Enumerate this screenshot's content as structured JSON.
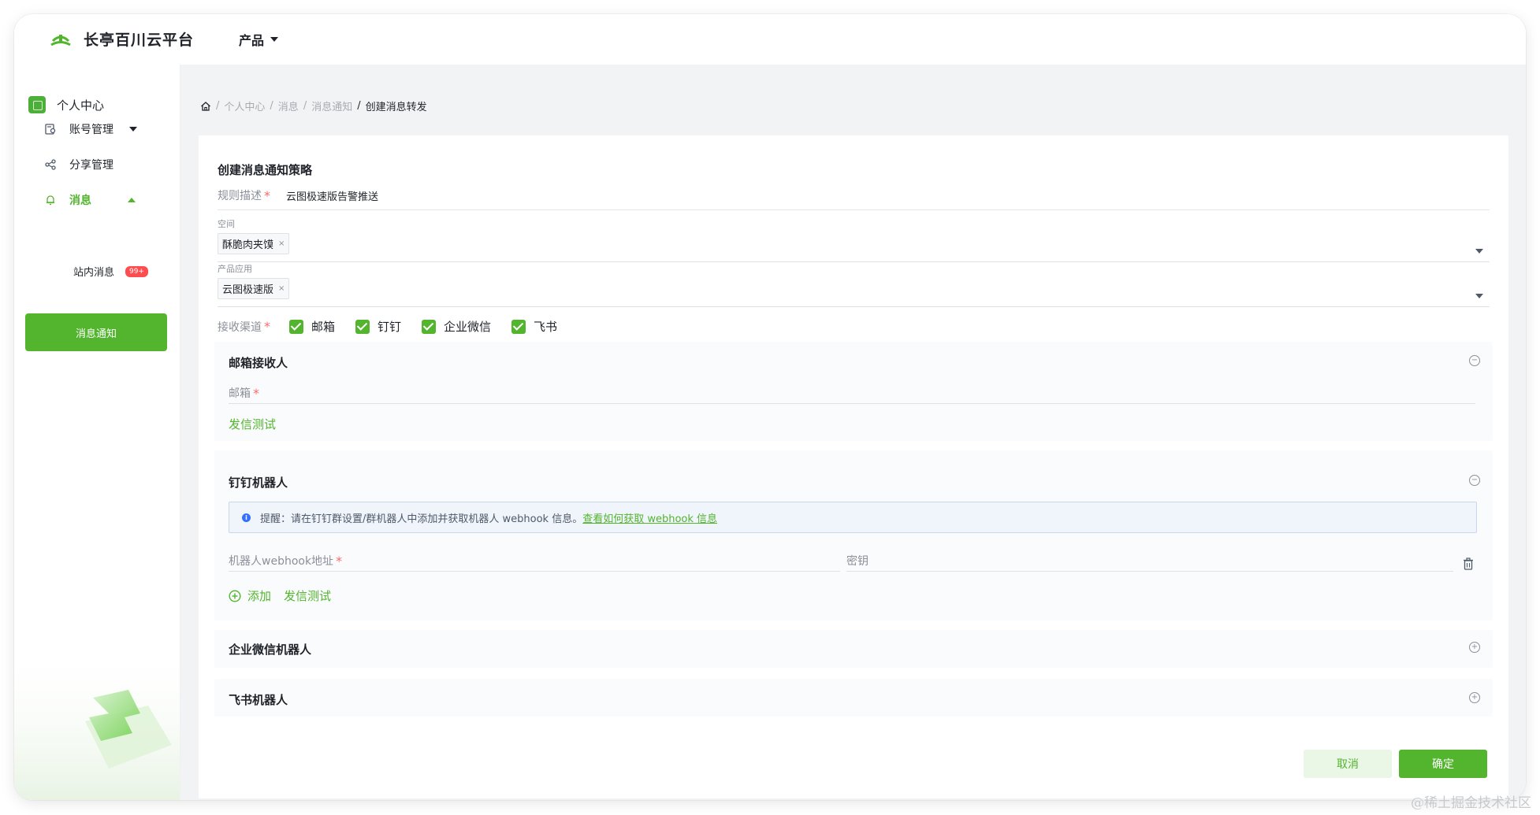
{
  "app": {
    "brand": "长亭百川云平台",
    "product_menu": "产品"
  },
  "sidebar": {
    "header": "个人中心",
    "items": [
      {
        "label": "账号管理",
        "icon": "account-icon"
      },
      {
        "label": "分享管理",
        "icon": "share-icon"
      },
      {
        "label": "消息",
        "icon": "bell-icon"
      }
    ],
    "sub_items": [
      {
        "label": "站内消息",
        "badge": "99+"
      },
      {
        "label": "消息通知"
      }
    ]
  },
  "breadcrumb": {
    "items": [
      "个人中心",
      "消息",
      "消息通知"
    ],
    "current": "创建消息转发"
  },
  "form": {
    "title": "创建消息通知策略",
    "desc_label": "规则描述",
    "desc_value": "云图极速版告警推送",
    "space_label": "空间",
    "space_tag": "酥脆肉夹馍",
    "app_label": "产品应用",
    "app_tag": "云图极速版",
    "channel_label": "接收渠道",
    "channels": [
      "邮箱",
      "钉钉",
      "企业微信",
      "飞书"
    ],
    "required_mark": "*",
    "tag_close": "×"
  },
  "email_section": {
    "title": "邮箱接收人",
    "field_label": "邮箱",
    "test_link": "发信测试"
  },
  "dingtalk_section": {
    "title": "钉钉机器人",
    "tip_text": "提醒：请在钉钉群设置/群机器人中添加并获取机器人 webhook 信息。",
    "tip_link": "查看如何获取 webhook 信息",
    "webhook_label": "机器人webhook地址",
    "secret_label": "密钥",
    "add_label": "添加",
    "test_link": "发信测试"
  },
  "wecom_section": {
    "title": "企业微信机器人"
  },
  "feishu_section": {
    "title": "飞书机器人"
  },
  "actions": {
    "cancel": "取消",
    "confirm": "确定"
  },
  "watermark": "@稀土掘金技术社区",
  "colors": {
    "accent": "#52b52d",
    "required": "#f56c6c",
    "page_bg": "#f2f3f5",
    "info_blue": "#3370ff"
  }
}
